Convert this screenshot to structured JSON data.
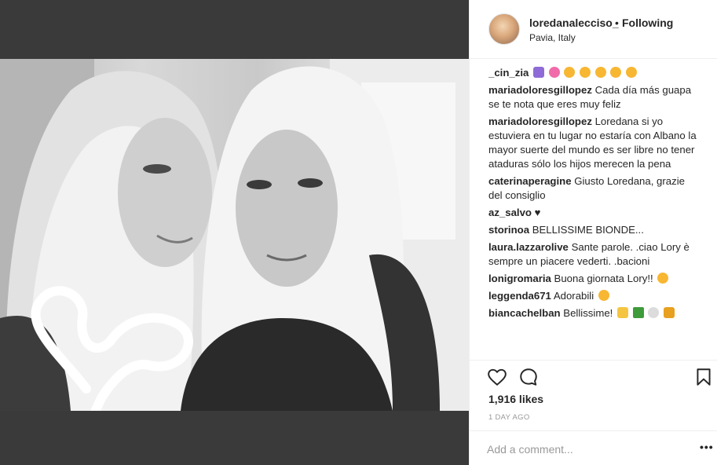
{
  "header": {
    "username": "loredanalecciso_",
    "separator": "•",
    "follow_status": "Following",
    "location": "Pavia, Italy"
  },
  "comments": [
    {
      "user": "_cin_zia",
      "text": ""
    },
    {
      "user": "mariadoloresgillopez",
      "text": "Cada día más guapa se te nota que eres muy feliz"
    },
    {
      "user": "mariadoloresgillopez",
      "text": "Loredana si yo estuviera en tu lugar no estaría con Albano la mayor suerte del mundo es ser libre no tener ataduras sólo los hijos merecen la pena"
    },
    {
      "user": "caterinaperagine",
      "text": "Giusto Loredana, grazie del consiglio"
    },
    {
      "user": "az_salvo",
      "text": "♥"
    },
    {
      "user": "storinoa",
      "text": "BELLISSIME BIONDE..."
    },
    {
      "user": "laura.lazzarolive",
      "text": "Sante parole. .ciao Lory è sempre un piacere vederti. .bacioni"
    },
    {
      "user": "lonigromaria",
      "text": "Buona giornata Lory!!"
    },
    {
      "user": "leggenda671",
      "text": "Adorabili"
    },
    {
      "user": "biancachelban",
      "text": "Bellissime!"
    }
  ],
  "emoji_colors": {
    "purple_heart": "#8e6bd6",
    "flower": "#f06ba8",
    "kiss_face": "#f7b733",
    "thumbs": "#f5c542",
    "tree": "#3e9b3a",
    "snowman": "#dcdcdc",
    "bouquet": "#e8a020"
  },
  "icons": {
    "like": "heart-outline-icon",
    "comment": "speech-bubble-icon",
    "save": "bookmark-icon",
    "more": "ellipsis-icon"
  },
  "likes": "1,916 likes",
  "time_ago": "1 DAY AGO",
  "add_comment": {
    "placeholder": "Add a comment...",
    "more_label": "•••"
  }
}
